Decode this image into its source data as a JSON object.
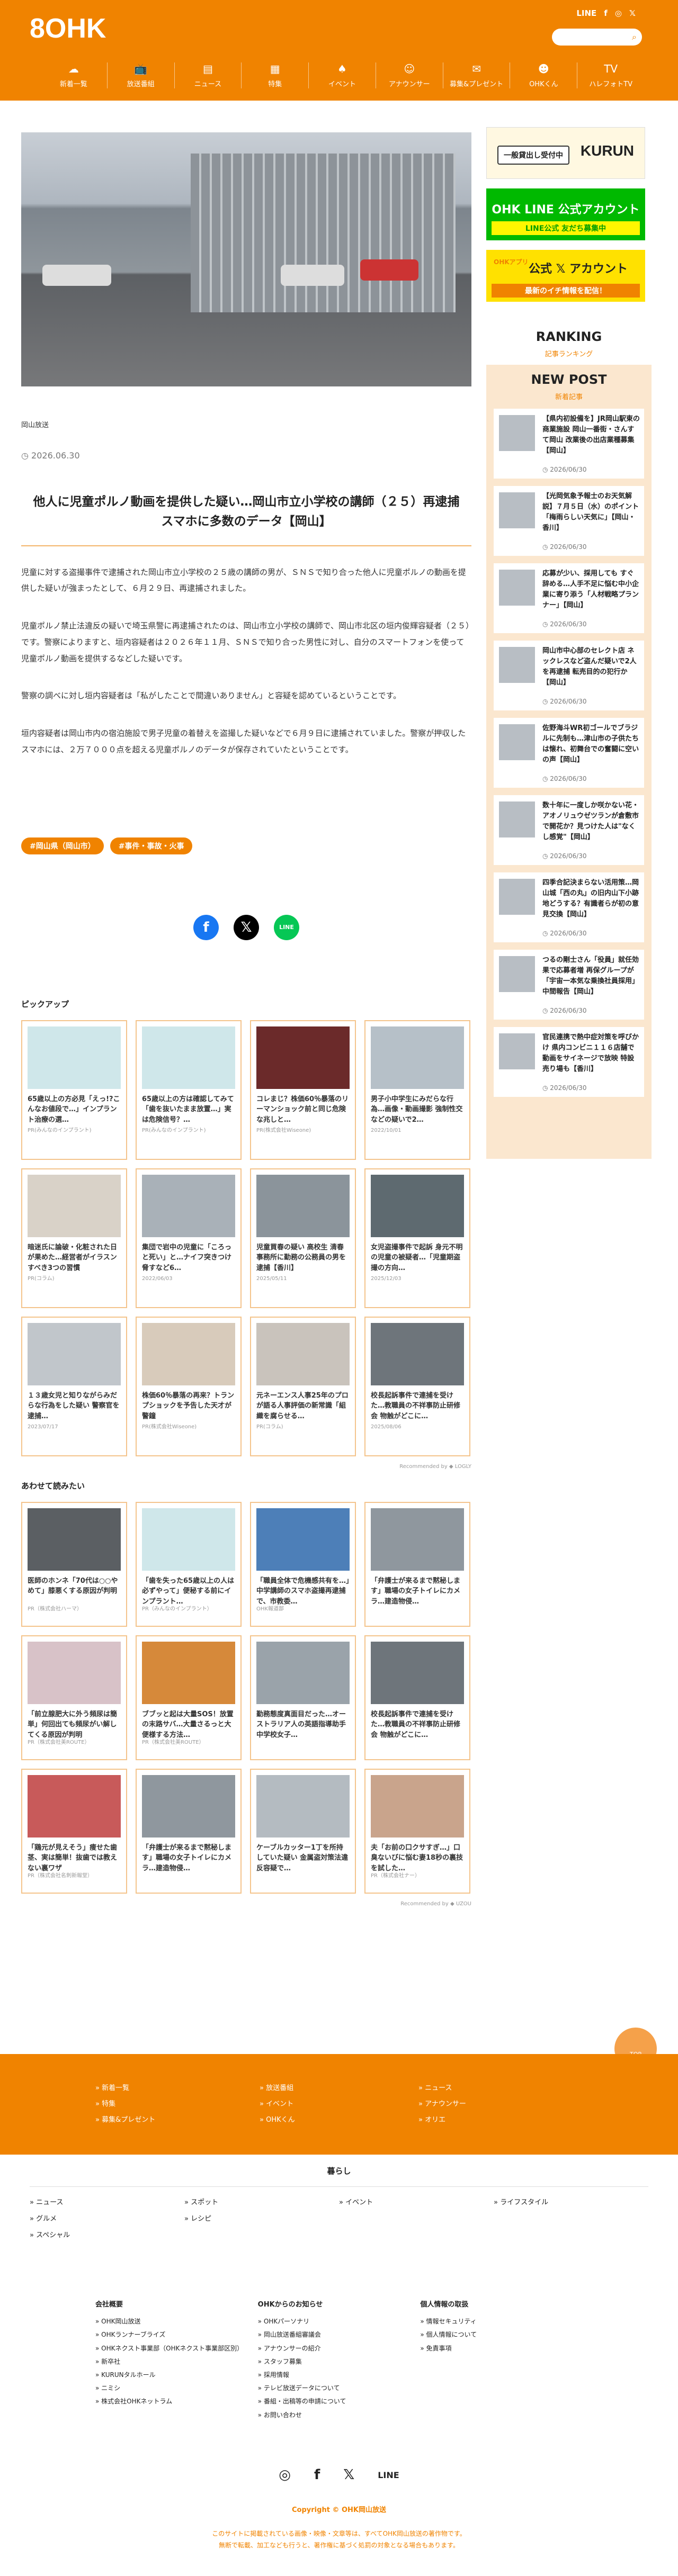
{
  "header": {
    "logo": "8OHK",
    "social": [
      "LINE",
      "f",
      "◎",
      "𝕏"
    ],
    "search_placeholder": "",
    "nav": [
      {
        "icon": "☁",
        "label": "新着一覧"
      },
      {
        "icon": "📺",
        "label": "放送番組"
      },
      {
        "icon": "▤",
        "label": "ニュース"
      },
      {
        "icon": "▦",
        "label": "特集"
      },
      {
        "icon": "♠",
        "label": "イベント"
      },
      {
        "icon": "☺",
        "label": "アナウンサー"
      },
      {
        "icon": "✉",
        "label": "募集&プレゼント"
      },
      {
        "icon": "☻",
        "label": "OHKくん"
      },
      {
        "icon": "TV",
        "label": "ハレフォトTV"
      }
    ]
  },
  "article": {
    "category": "岡山放送",
    "date": "2026.06.30",
    "title": "他人に児童ポルノ動画を提供した疑い…岡山市立小学校の講師（２５）再逮捕 スマホに多数のデータ【岡山】",
    "paragraphs": [
      "児童に対する盗撮事件で逮捕された岡山市立小学校の２５歳の講師の男が、ＳＮＳで知り合った他人に児童ポルノの動画を提供した疑いが強まったとして、６月２９日、再逮捕されました。",
      "児童ポルノ禁止法違反の疑いで埼玉県警に再逮捕されたのは、岡山市立小学校の講師で、岡山市北区の垣内俊輝容疑者（２５）です。警察によりますと、垣内容疑者は２０２６年１１月、ＳＮＳで知り合った男性に対し、自分のスマートフォンを使って児童ポルノ動画を提供するなどした疑いです。",
      "警察の調べに対し垣内容疑者は「私がしたことで間違いありません」と容疑を認めているということです。",
      "垣内容疑者は岡山市内の宿泊施設で男子児童の着替えを盗撮した疑いなどで６月９日に逮捕されていました。警察が押収したスマホには、２万７０００点を超える児童ポルノのデータが保存されていたということです。"
    ],
    "tags": [
      "#岡山県（岡山市）",
      "#事件・事故・火事"
    ],
    "share": [
      "f",
      "𝕏",
      "LINE"
    ]
  },
  "pickup": {
    "heading": "ピックアップ",
    "items": [
      {
        "title": "65歳以上の方必見「えっ!?こんなお値段で…」インプラント治療の選…",
        "src": "PR(みんなのインプラント)"
      },
      {
        "title": "65歳以上の方は確認してみて「歯を抜いたまま放置…」実は危険信号？…",
        "src": "PR(みんなのインプラント)"
      },
      {
        "title": "コレまじ？株価60％暴落のリーマンショック前と同じ危険な兆しと…",
        "src": "PR(株式会社Wiseone)"
      },
      {
        "title": "男子小中学生にみだらな行為…画像・動画撮影 強制性交などの疑いで2…",
        "src": "2022/10/01"
      },
      {
        "title": "暗迷氏に論破・化粧された日が果めた…経営者がイラスンすべき3つの習慣",
        "src": "PR(コラム)"
      },
      {
        "title": "集団で岩中の児童に「ころっと死い」と…ナイフ突きつけ脅すなど6…",
        "src": "2022/06/03"
      },
      {
        "title": "児童買春の疑い 高校生 清春事務所に勤務の公務員の男を逮捕【香川】",
        "src": "2025/05/11"
      },
      {
        "title": "女児盗撮事件で起訴 身元不明の児童の被疑者…「児童期盗撮の方向…",
        "src": "2025/12/03"
      },
      {
        "title": "１３歳女児と知りながらみだらな行為をした疑い 警察官を逮捕…",
        "src": "2023/07/17"
      },
      {
        "title": "株価60％暴落の再来？トランプショックを予告した天才が警鐘",
        "src": "PR(株式会社Wiseone)"
      },
      {
        "title": "元ネーエンス人事25年のプロが語る人事評価の新常識「組織を腐らせる…",
        "src": "PR(コラム)"
      },
      {
        "title": "校長起訴事件で連捕を受けた…教職員の不祥事防止研修会 物触がどこに…",
        "src": "2025/08/06"
      }
    ],
    "recommended": "Recommended by ◆ LOGLY"
  },
  "also_read": {
    "heading": "あわせて読みたい",
    "items": [
      {
        "title": "医師のホンネ「70代は○○やめて」膝悪くする原因が判明",
        "src": "PR（株式会社ハーマ）"
      },
      {
        "title": "「歯を失った65歳以上の人は必ずやって」便秘する前にインプラント…",
        "src": "PR（みんなのインプラント）"
      },
      {
        "title": "「職員全体で危機感共有を…」中学講師のスマホ盗撮再逮捕で、市教委…",
        "src": "OHK報道部"
      },
      {
        "title": "「弁護士が来るまで黙秘します」職場の女子トイレにカメラ…建造物侵…",
        "src": ""
      },
      {
        "title": "「前立腺肥大に外う頻尿は簡単」何回出ても頻尿がい解してくる原因が判明",
        "src": "PR（株式会社美ROUTE）"
      },
      {
        "title": "ブブッと起は大量SOS！放置の末路サバ…大量さるっと大便様する方法…",
        "src": "PR（株式会社美ROUTE）"
      },
      {
        "title": "勤務態度真面目だった…オーストラリア人の英語指導助手 中学校女子…",
        "src": ""
      },
      {
        "title": "校長起訴事件で連捕を受けた…教職員の不祥事防止研修会 物触がどこに…",
        "src": ""
      },
      {
        "title": "「鶏元が見えそう」痩せた歯茎、実は簡単！抜歯では教えない裏ワザ",
        "src": "PR（株式会社名刺新報堂）"
      },
      {
        "title": "「弁護士が来るまで黙秘します」職場の女子トイレにカメラ…建造物侵…",
        "src": ""
      },
      {
        "title": "ケーブルカッター1丁を所持していた疑い 金属盗対策法違反容疑で…",
        "src": ""
      },
      {
        "title": "夫「お前の口クサすぎ…」口臭ないびに悩む妻18秒の裏技を試した…",
        "src": "PR（株式会社ナー）"
      }
    ],
    "recommended": "Recommended by ◆ UZOU"
  },
  "sidebar": {
    "banner1_pill": "一般貸出し受付中",
    "banner1_brand": "KURUN",
    "banner2_title": "OHK LINE 公式アカウント",
    "banner2_sub": "LINE公式 友だち募集中",
    "banner3_app": "OHKアプリ",
    "banner3_title": "公式 𝕏 アカウント",
    "banner3_sub": "最新のイチ情報を配信！",
    "ranking": "RANKING",
    "ranking_sub": "記事ランキング",
    "newpost": "NEW POST",
    "newpost_sub": "新着記事",
    "posts": [
      {
        "title": "【県内初設備を】JR岡山駅東の商業施設 岡山一番街・さんすて岡山 改業後の出店業種募集【岡山】",
        "date": "2026/06/30"
      },
      {
        "title": "【光岡気象予報士のお天気解説】７月５日（水）のポイント「梅雨らしい天気に」【岡山・香川】",
        "date": "2026/06/30"
      },
      {
        "title": "応募が少い、採用しても すぐ辞める…人手不足に悩む中小企業に寄り添う「人材戦略プランナー」【岡山】",
        "date": "2026/06/30"
      },
      {
        "title": "岡山市中心部のセレクト店 ネックレスなど盗んだ疑いで2人を再逮捕 転売目的の犯行か【岡山】",
        "date": "2026/06/30"
      },
      {
        "title": "佐野海斗WR初ゴールでブラジルに先制も…津山市の子供たちは懐れ、初舞台での奮闘に空いの声【岡山】",
        "date": "2026/06/30"
      },
      {
        "title": "数十年に一度しか咲かない花・アオノリュウゼツランが倉敷市で開花か？見つけた人は\"なくし感覚\"【岡山】",
        "date": "2026/06/30"
      },
      {
        "title": "四季合記決まらない活用策…岡山城「西の丸」の旧内山下小跡地どうする？有識者らが初の意見交換【岡山】",
        "date": "2026/06/30"
      },
      {
        "title": "つるの剛士さん「役員」就任効果で応募者増 再保グループが「宇宙一本気な乗換社員採用」中間報告【岡山】",
        "date": "2026/06/30"
      },
      {
        "title": "官民連携で熱中症対策を呼びかけ 県内コンビニ１１６店舗で動画をサイネージで放映 特設売り場も【香川】",
        "date": "2026/06/30"
      }
    ]
  },
  "footer": {
    "totop": "TOP",
    "col1": [
      "» 新着一覧",
      "» 特集",
      "» 募集&プレゼント"
    ],
    "col2": [
      "» 放送番組",
      "» イベント",
      "» OHKくん"
    ],
    "col3": [
      "» ニュース",
      "» アナウンサー",
      "» オリエ"
    ],
    "kurashi": "暮らし",
    "krow1": [
      "» ニュース",
      "» スポット",
      "» イベント",
      "» ライフスタイル"
    ],
    "krow2": [
      "» グルメ",
      "» レシピ",
      "",
      ""
    ],
    "krow3": [
      "» スペシャル",
      "",
      "",
      ""
    ],
    "info_heads": [
      "会社概要",
      "OHKからのお知らせ",
      "個人情報の取扱"
    ],
    "info1": [
      "» OHK岡山放送",
      "» OHKランナーブライズ",
      "» OHKネクスト事業部（OHKネクスト事業部区別）",
      "» 新卒社",
      "» KURUNタルホール",
      "» ニミシ",
      "» 株式会社OHKネットラム"
    ],
    "info2": [
      "» OHKパーソナリ",
      "» 岡山放送番組審議会",
      "» アナウンサーの紹介",
      "» スタッフ募集",
      "» 採用情報",
      "» テレビ放送データについて",
      "» 番組・出稿等の申請について",
      "» お問い合わせ"
    ],
    "info3": [
      "» 情報セキュリティ",
      "» 個人情報について",
      "» 免責事項"
    ],
    "social": [
      "◎",
      "f",
      "𝕏",
      "LINE"
    ],
    "copyright": "Copyright © OHK岡山放送",
    "note1": "このサイトに掲載されている画像・映像・文章等は、すべてOHK岡山放送の著作物です。",
    "note2": "無断で転載、加工なども行うと、著作権に基づく処罰の対象となる場合もあります。"
  }
}
